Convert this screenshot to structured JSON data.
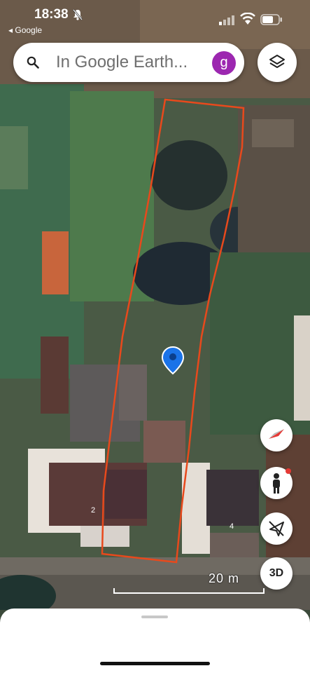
{
  "status_bar": {
    "time": "18:38",
    "back_app": "◂ Google"
  },
  "search": {
    "placeholder": "In Google Earth...",
    "avatar_letter": "g"
  },
  "map": {
    "scale_label": "20 m",
    "house_numbers": [
      "2",
      "4"
    ],
    "outline_color": "#e8491c",
    "pin_color": "#1a73e8"
  },
  "controls": {
    "three_d_label": "3D"
  },
  "icons": [
    "search-icon",
    "layers-icon",
    "compass-icon",
    "pegman-icon",
    "location-off-icon",
    "bell-off-icon",
    "wifi-icon",
    "battery-icon"
  ]
}
